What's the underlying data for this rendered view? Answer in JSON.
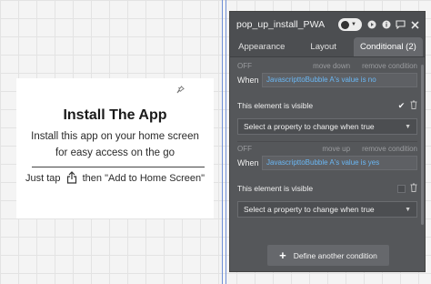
{
  "popup": {
    "title": "Install The App",
    "desc_line1": "Install this app on your home screen",
    "desc_line2": "for easy access on the go",
    "hint_before": "Just tap",
    "hint_after": "then \"Add to Home Screen\""
  },
  "panel": {
    "title": "pop_up_install_PWA",
    "tabs": [
      {
        "label": "Appearance",
        "active": false
      },
      {
        "label": "Layout",
        "active": false
      },
      {
        "label": "Conditional (2)",
        "active": true
      }
    ],
    "conditions": [
      {
        "toggle_label": "OFF",
        "actions": [
          "move down",
          "remove condition"
        ],
        "when_label": "When",
        "expression": "JavascripttoBubble A's value is no",
        "property_label": "This element is visible",
        "checked": true,
        "select_placeholder": "Select a property to change when true"
      },
      {
        "toggle_label": "OFF",
        "actions": [
          "move up",
          "remove condition"
        ],
        "when_label": "When",
        "expression": "JavascripttoBubble A's value is yes",
        "property_label": "This element is visible",
        "checked": false,
        "select_placeholder": "Select a property to change when true"
      }
    ],
    "define_label": "Define another condition"
  },
  "colors": {
    "panel_bg": "#55575a",
    "expression_text": "#6ab7f4",
    "guide_line": "#6f8fd6"
  }
}
